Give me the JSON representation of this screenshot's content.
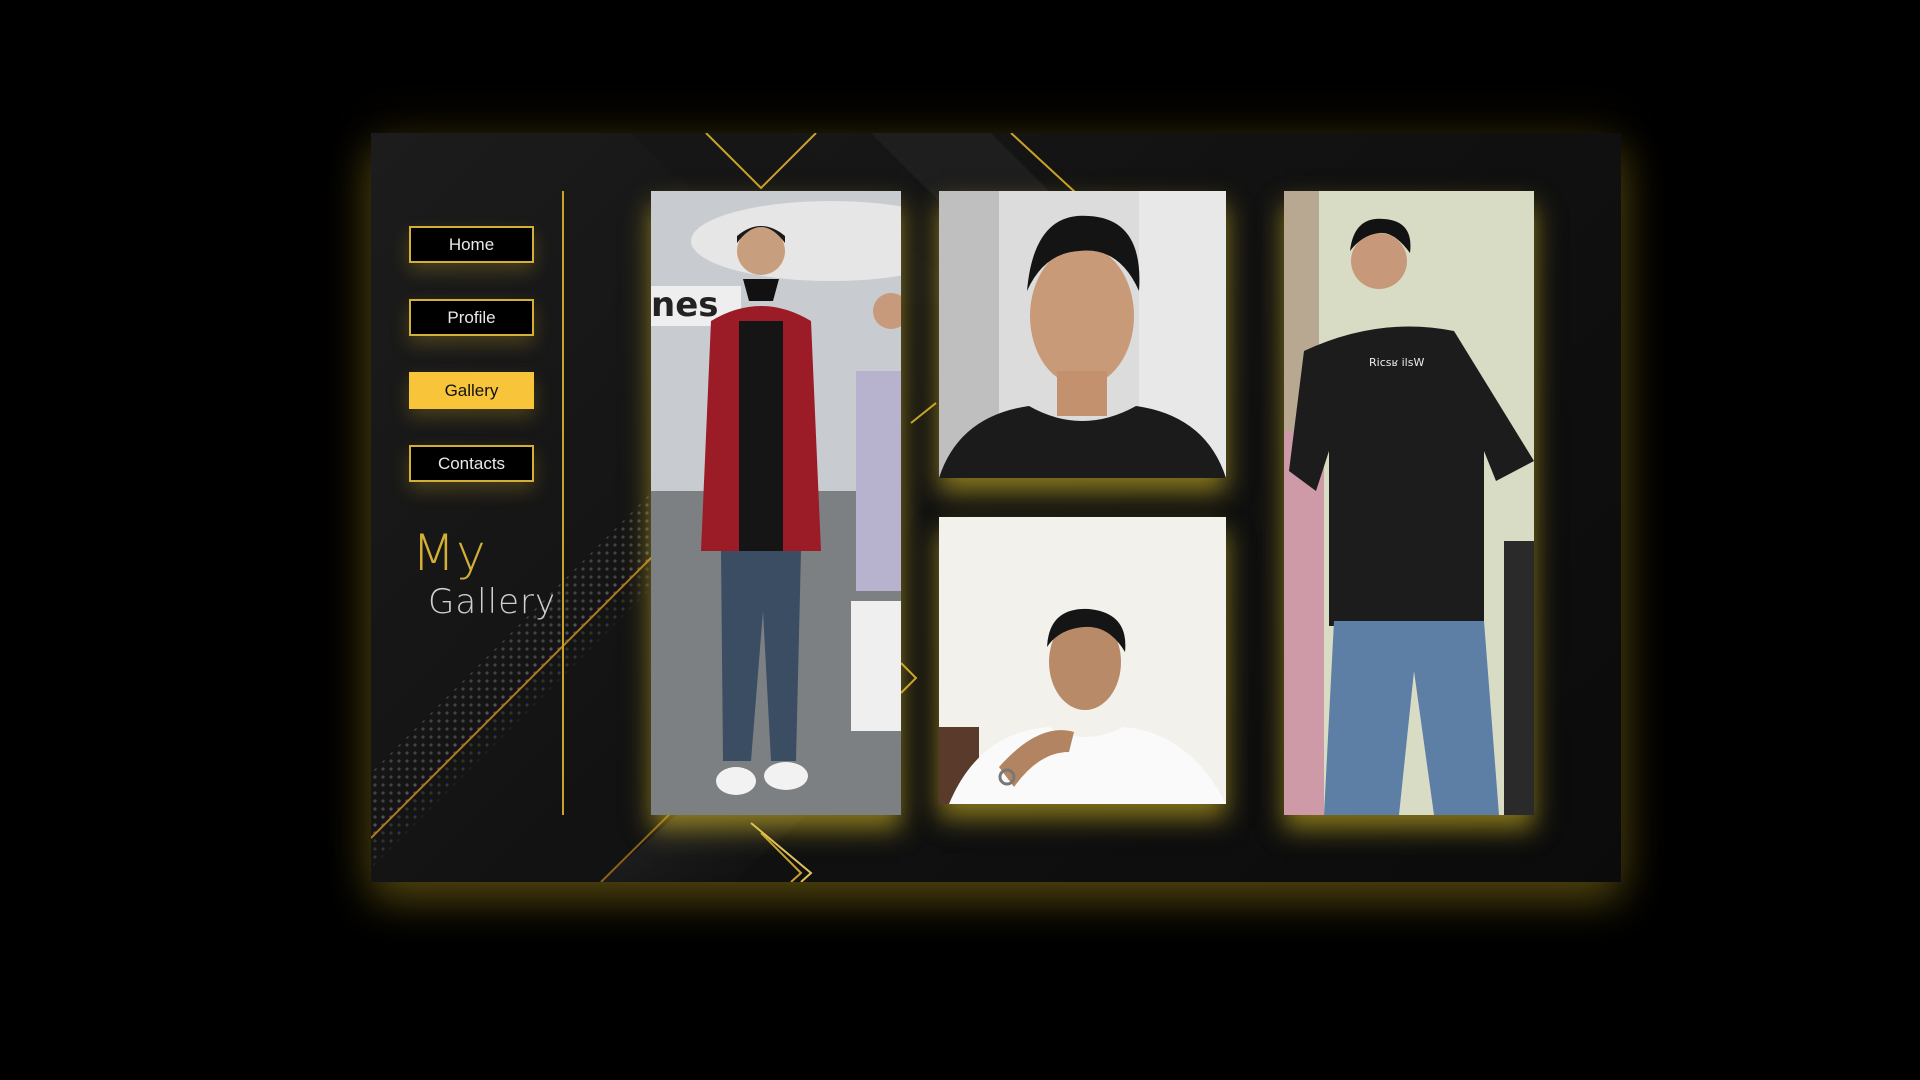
{
  "nav": {
    "items": [
      {
        "label": "Home",
        "active": false
      },
      {
        "label": "Profile",
        "active": false
      },
      {
        "label": "Gallery",
        "active": true
      },
      {
        "label": "Contacts",
        "active": false
      }
    ]
  },
  "title": {
    "line1": "My",
    "line2": "Gallery"
  },
  "gallery": {
    "photos": [
      {
        "subject": "person-at-airport-red-jacket"
      },
      {
        "subject": "person-selfie-black-shirt"
      },
      {
        "subject": "person-selfie-white-shirt"
      },
      {
        "subject": "person-standing-black-tshirt"
      }
    ]
  },
  "colors": {
    "accent": "#f8c53a",
    "gold": "#d4af37",
    "background": "#000000",
    "panel": "#141414"
  }
}
